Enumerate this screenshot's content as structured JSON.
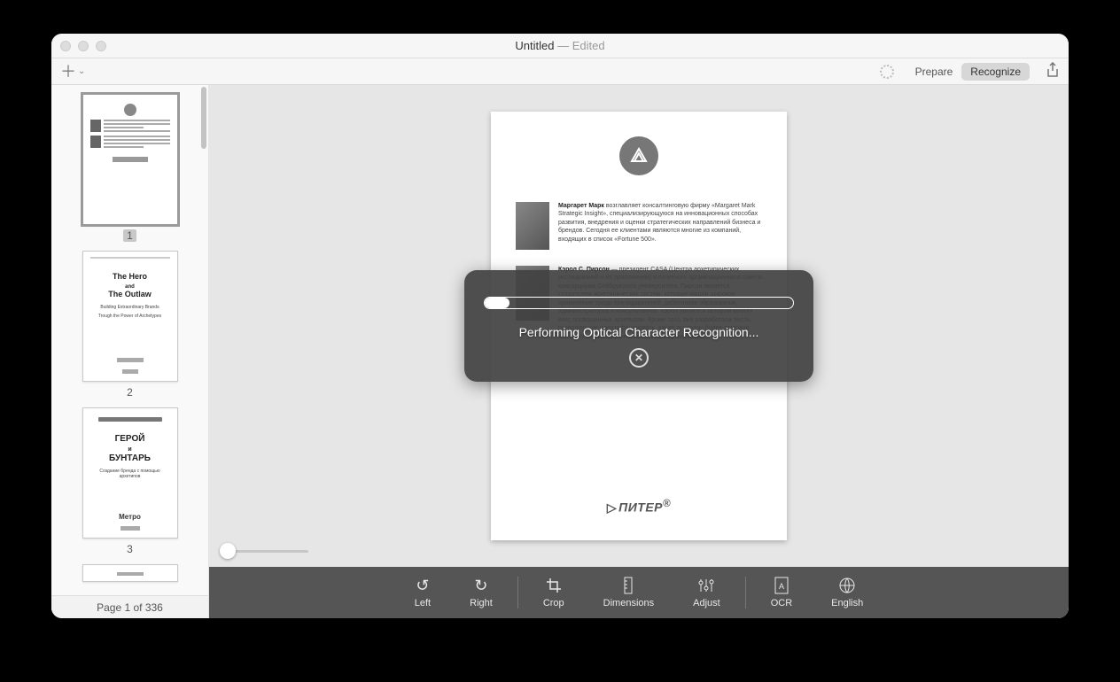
{
  "window": {
    "title": "Untitled",
    "status_suffix": " — ",
    "status": "Edited"
  },
  "toolbar": {
    "prepare_label": "Prepare",
    "recognize_label": "Recognize"
  },
  "sidebar": {
    "thumbs": [
      {
        "num": "1",
        "selected": true
      },
      {
        "num": "2",
        "selected": false
      },
      {
        "num": "3",
        "selected": false
      }
    ],
    "thumb2_title_line1": "The Hero",
    "thumb2_title_and": "and",
    "thumb2_title_line2": "The Outlaw",
    "thumb2_sub1": "Building Extraordinary Brands",
    "thumb2_sub2": "Trough the Power of Archetypes",
    "thumb3_title_line1": "ГЕРОЙ",
    "thumb3_title_and": "и",
    "thumb3_title_line2": "БУНТАРЬ",
    "thumb3_sub": "Создание бренда с помощью архетипов",
    "thumb3_pub": "Метро",
    "footer": "Page 1 of 336"
  },
  "page": {
    "bio1_name": "Маргарет Марк",
    "bio1_text": " возглавляет консалтинговую фирму «Margaret Mark Strategic Insight», специализирующуюся на инновационных способах развития, внедрения и оценки стратегических направлений бизнеса и брендов. Сегодня ее клиентами являются многие из компаний, входящих в список «Fortune 500».",
    "bio2_name": "Кэрол С. Пирсон",
    "bio2_text": " — президент CASA (Центра архетипических исследований и их приложений) и почетного организационного совета консорциума Сейбрукского университета. Пирсон является создателем архетипических систем, которые нашли широкое применение среди преподавателей, работников образования, администраторов и консультантов. Кэрол является автором многих книг, посвященных архетипам. Кроме того, она разработала тесты, позволяющие идентифицировать, какие архетипы более присущи человеку, семье, группе и коллективу организации.",
    "publisher": "ПИТЕР"
  },
  "overlay": {
    "message": "Performing Optical Character Recognition...",
    "progress_percent": 8
  },
  "bottom_tools": {
    "left": "Left",
    "right": "Right",
    "crop": "Crop",
    "dimensions": "Dimensions",
    "adjust": "Adjust",
    "ocr": "OCR",
    "english": "English"
  }
}
